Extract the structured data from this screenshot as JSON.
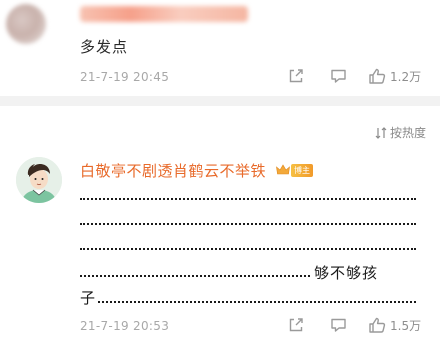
{
  "comment1": {
    "text": "多发点",
    "time": "21-7-19 20:45",
    "likes": "1.2万"
  },
  "sort": {
    "label": "按热度"
  },
  "comment2": {
    "username": "白敬亭不剧透肖鹤云不举铁",
    "badge_label": "博主",
    "line4_suffix": "够不够孩",
    "line5_prefix": "子",
    "time": "21-7-19 20:53",
    "likes": "1.5万"
  },
  "colors": {
    "username": "#e86a2a",
    "meta": "#a8a8a8",
    "divider": "#f2f2f2",
    "badge": "#f19a2a"
  },
  "icons": {
    "share": "share-icon",
    "comment": "comment-icon",
    "like": "thumbs-up-icon",
    "sort": "sort-icon",
    "crown": "crown-icon"
  }
}
